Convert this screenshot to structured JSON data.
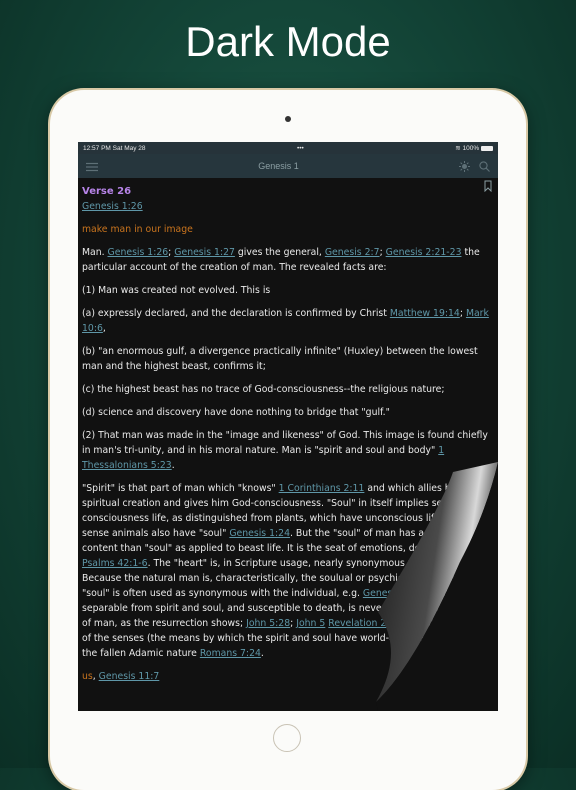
{
  "headline": "Dark Mode",
  "status": {
    "time": "12:57 PM  Sat May 28",
    "dots": "•••",
    "battery": "100%"
  },
  "nav": {
    "title": "Genesis 1",
    "menu_icon": "hamburger-icon",
    "theme_icon": "brightness-icon",
    "search_icon": "search-icon"
  },
  "colors": {
    "verse": "#b784e8",
    "link": "#5f97a8",
    "highlight": "#c9741e",
    "background": "#111111"
  },
  "verse": {
    "label": "Verse 26",
    "ref": "Genesis 1:26"
  },
  "paragraphs": [
    [
      {
        "t": "make man in our image",
        "c": "orange"
      }
    ],
    [
      {
        "t": "Man. "
      },
      {
        "t": "Genesis 1:26",
        "c": "link"
      },
      {
        "t": "; "
      },
      {
        "t": "Genesis 1:27",
        "c": "link"
      },
      {
        "t": " gives the general, "
      },
      {
        "t": "Genesis 2:7",
        "c": "link"
      },
      {
        "t": "; "
      },
      {
        "t": "Genesis 2:21-23",
        "c": "link"
      },
      {
        "t": " the particular account of the creation of man. The revealed facts are:"
      }
    ],
    [
      {
        "t": "(1) Man was created not evolved. This is"
      }
    ],
    [
      {
        "t": "(a) expressly declared, and the declaration is confirmed by Christ "
      },
      {
        "t": "Matthew 19:14",
        "c": "link"
      },
      {
        "t": "; "
      },
      {
        "t": "Mark 10:6",
        "c": "link"
      },
      {
        "t": ","
      }
    ],
    [
      {
        "t": "(b) \"an enormous gulf, a divergence practically infinite\" (Huxley) between the lowest man and the highest beast, confirms it;"
      }
    ],
    [
      {
        "t": "(c) the highest beast has no trace of God-consciousness--the religious nature;"
      }
    ],
    [
      {
        "t": "(d) science and discovery have done nothing to bridge that \"gulf.\""
      }
    ],
    [
      {
        "t": "(2) That man was made in the \"image and likeness\" of God. This image is found chiefly in man's tri-unity, and in his moral nature. Man is \"spirit and soul and body\" "
      },
      {
        "t": "1 Thessalonians 5:23",
        "c": "link"
      },
      {
        "t": "."
      }
    ],
    [
      {
        "t": "\"Spirit\" is that part of man which \"knows\" "
      },
      {
        "t": "1 Corinthians 2:11",
        "c": "link"
      },
      {
        "t": " and which allies him to the spiritual creation and gives him God-consciousness. \"Soul\" in itself implies self-consciousness life, as distinguished from plants, which have unconscious life. In that sense animals also have \"soul\" "
      },
      {
        "t": "Genesis 1:24",
        "c": "link"
      },
      {
        "t": ". But the \"soul\" of man has a vaster content than \"soul\" as applied to beast life. It is the seat of emotions, desires, affections "
      },
      {
        "t": "Psalms 42:1-6",
        "c": "link"
      },
      {
        "t": ". The \"heart\" is, in Scripture usage, nearly synonymous with \"soul.\" Because the natural man is, characteristically, the soulual or psychical, which condition \"soul\" is often used as synonymous with the individual, e.g. "
      },
      {
        "t": "Genesis",
        "c": "link"
      },
      {
        "t": " ... elements. The separable from spirit and soul, and susceptible to death, is nevertheless an integral part of man, as the resurrection shows; "
      },
      {
        "t": "John 5:28",
        "c": "link"
      },
      {
        "t": "; "
      },
      {
        "t": "John 5",
        "c": "link"
      },
      {
        "t": " "
      },
      {
        "t": "Revelation 20:11-13",
        "c": "link"
      },
      {
        "t": ". It is the seat of the senses (the means by which the spirit and soul have world-consciousness) and of the fallen Adamic nature "
      },
      {
        "t": "Romans 7:24",
        "c": "link"
      },
      {
        "t": "."
      }
    ],
    [
      {
        "t": "us",
        "c": "orange"
      },
      {
        "t": ", "
      },
      {
        "t": "Genesis 11:7",
        "c": "link"
      }
    ]
  ]
}
